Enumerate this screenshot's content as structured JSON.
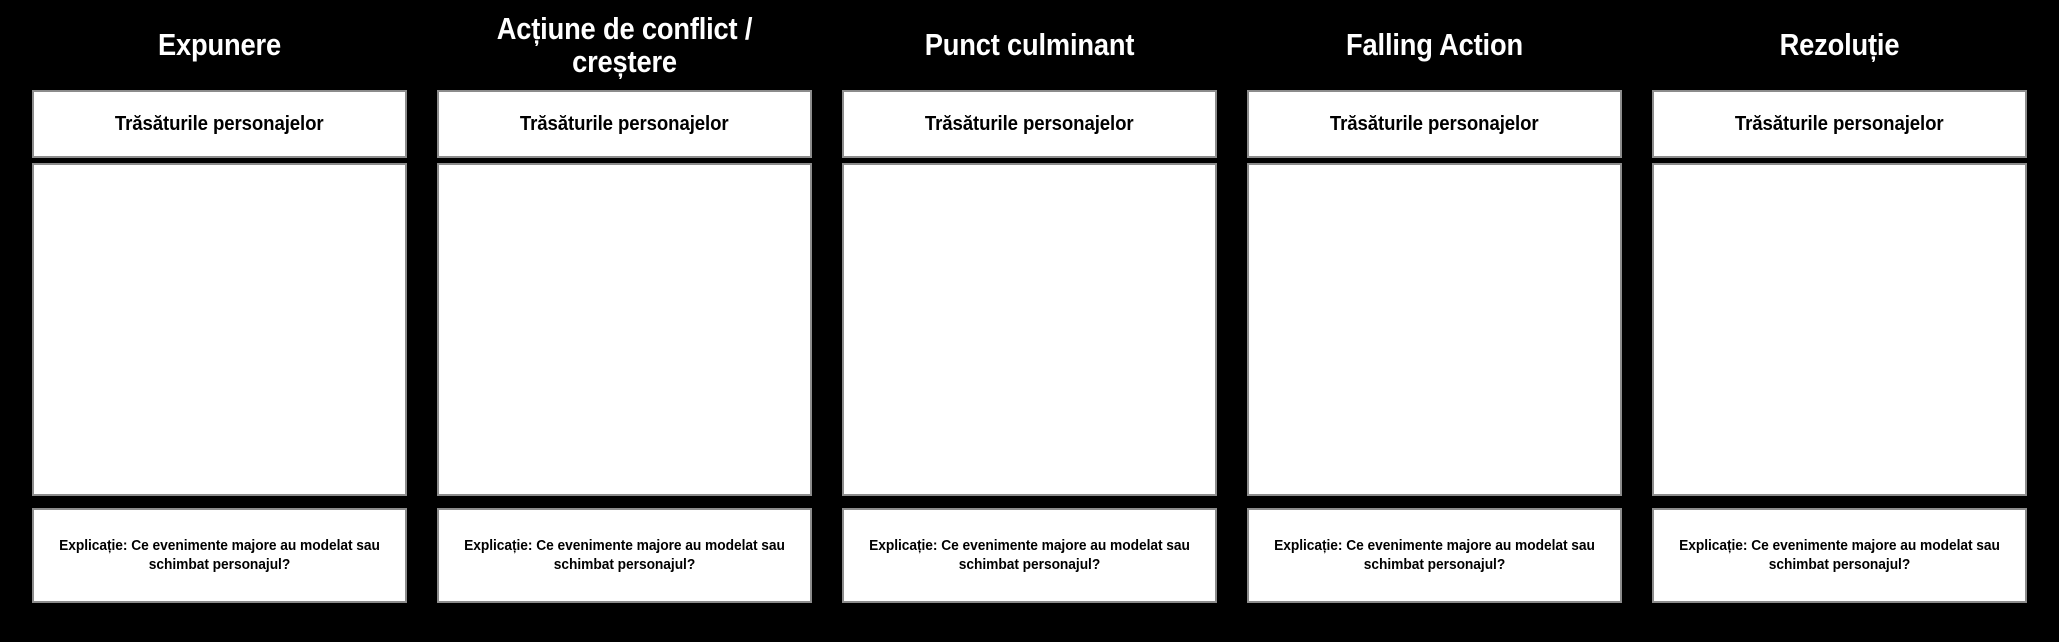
{
  "board": {
    "background_color": "#000000",
    "cell_background_color": "#ffffff",
    "cell_border_color": "#8c8c8c",
    "heading_text_color": "#ffffff",
    "cell_text_color": "#000000"
  },
  "shared": {
    "trait_label": "Trăsăturile personajelor",
    "explanation_text": "Explicație: Ce evenimente majore au modelat sau schimbat personajul?"
  },
  "columns": [
    {
      "heading": "Expunere",
      "trait_label": "Trăsăturile personajelor",
      "canvas_content": "",
      "explanation_text": "Explicație: Ce evenimente majore au modelat sau schimbat personajul?"
    },
    {
      "heading": "Acțiune de conflict /\ncreștere",
      "trait_label": "Trăsăturile personajelor",
      "canvas_content": "",
      "explanation_text": "Explicație: Ce evenimente majore au modelat sau schimbat personajul?"
    },
    {
      "heading": "Punct culminant",
      "trait_label": "Trăsăturile personajelor",
      "canvas_content": "",
      "explanation_text": "Explicație: Ce evenimente majore au modelat sau schimbat personajul?"
    },
    {
      "heading": "Falling Action",
      "trait_label": "Trăsăturile personajelor",
      "canvas_content": "",
      "explanation_text": "Explicație: Ce evenimente majore au modelat sau schimbat personajul?"
    },
    {
      "heading": "Rezoluție",
      "trait_label": "Trăsăturile personajelor",
      "canvas_content": "",
      "explanation_text": "Explicație: Ce evenimente majore au modelat sau schimbat personajul?"
    }
  ]
}
